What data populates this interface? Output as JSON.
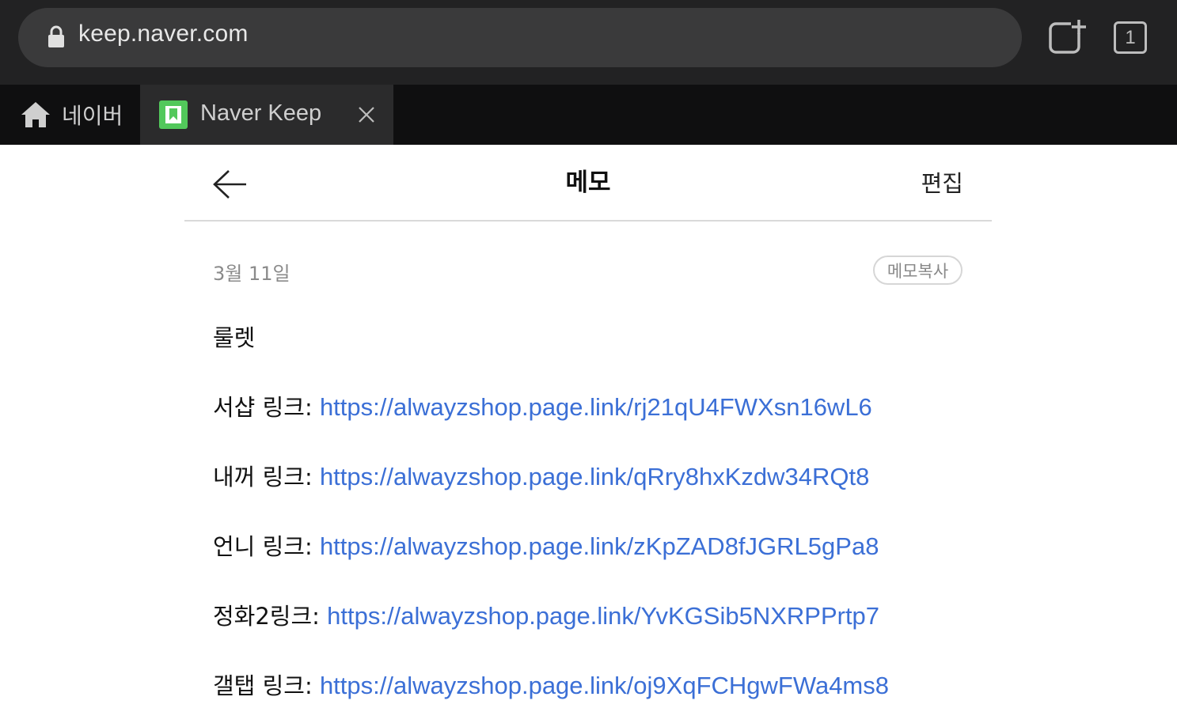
{
  "browser": {
    "url": "keep.naver.com",
    "tab_count": "1",
    "tabs": [
      {
        "label": "네이버"
      },
      {
        "label": "Naver Keep"
      }
    ]
  },
  "header": {
    "title": "메모",
    "edit_label": "편집"
  },
  "memo": {
    "date": "3월 11일",
    "copy_label": "메모복사",
    "title": "룰렛",
    "lines": [
      {
        "label": "서샵 링크: ",
        "link": "https://alwayzshop.page.link/rj21qU4FWXsn16wL6"
      },
      {
        "label": "내꺼 링크: ",
        "link": "https://alwayzshop.page.link/qRry8hxKzdw34RQt8"
      },
      {
        "label": "언니 링크: ",
        "link": "https://alwayzshop.page.link/zKpZAD8fJGRL5gPa8"
      },
      {
        "label": "정화2링크: ",
        "link": "https://alwayzshop.page.link/YvKGSib5NXRPPrtp7"
      },
      {
        "label": "갤탭 링크: ",
        "link": "https://alwayzshop.page.link/oj9XqFCHgwFWa4ms8"
      }
    ]
  },
  "colors": {
    "link": "#3b6fd6",
    "favicon": "#52c85b",
    "toolbar": "#222223"
  }
}
